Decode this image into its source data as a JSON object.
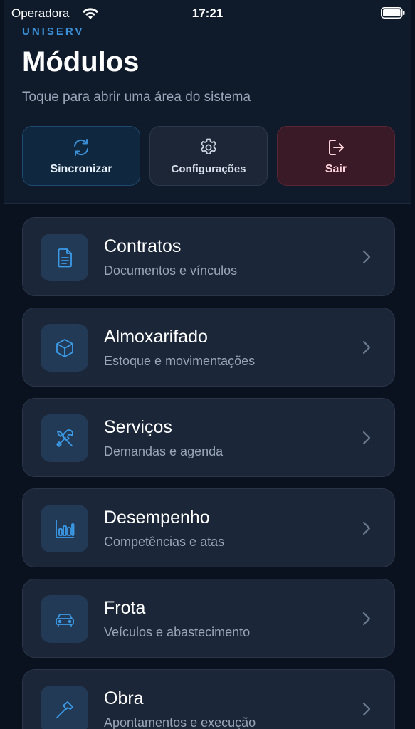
{
  "status_bar": {
    "carrier": "Operadora",
    "time": "17:21",
    "wifi_icon": "wifi-icon",
    "battery_icon": "battery-icon"
  },
  "header": {
    "brand": "UNISERV",
    "title": "Módulos",
    "subtitle": "Toque para abrir uma área do sistema"
  },
  "actions": [
    {
      "label": "Sincronizar",
      "icon": "sync-icon"
    },
    {
      "label": "Configurações",
      "icon": "gear-icon"
    },
    {
      "label": "Sair",
      "icon": "logout-icon"
    }
  ],
  "modules": [
    {
      "title": "Contratos",
      "subtitle": "Documentos e vínculos",
      "icon": "document-icon"
    },
    {
      "title": "Almoxarifado",
      "subtitle": "Estoque e movimentações",
      "icon": "box-icon"
    },
    {
      "title": "Serviços",
      "subtitle": "Demandas e agenda",
      "icon": "tools-icon"
    },
    {
      "title": "Desempenho",
      "subtitle": "Competências e atas",
      "icon": "bar-chart-icon"
    },
    {
      "title": "Frota",
      "subtitle": "Veículos e abastecimento",
      "icon": "car-icon"
    },
    {
      "title": "Obra",
      "subtitle": "Apontamentos e execução",
      "icon": "hammer-icon"
    }
  ],
  "colors": {
    "accent": "#3b8fd6",
    "background": "#0a1220",
    "card": "#1b2639",
    "danger_bg": "#3a1a26"
  }
}
